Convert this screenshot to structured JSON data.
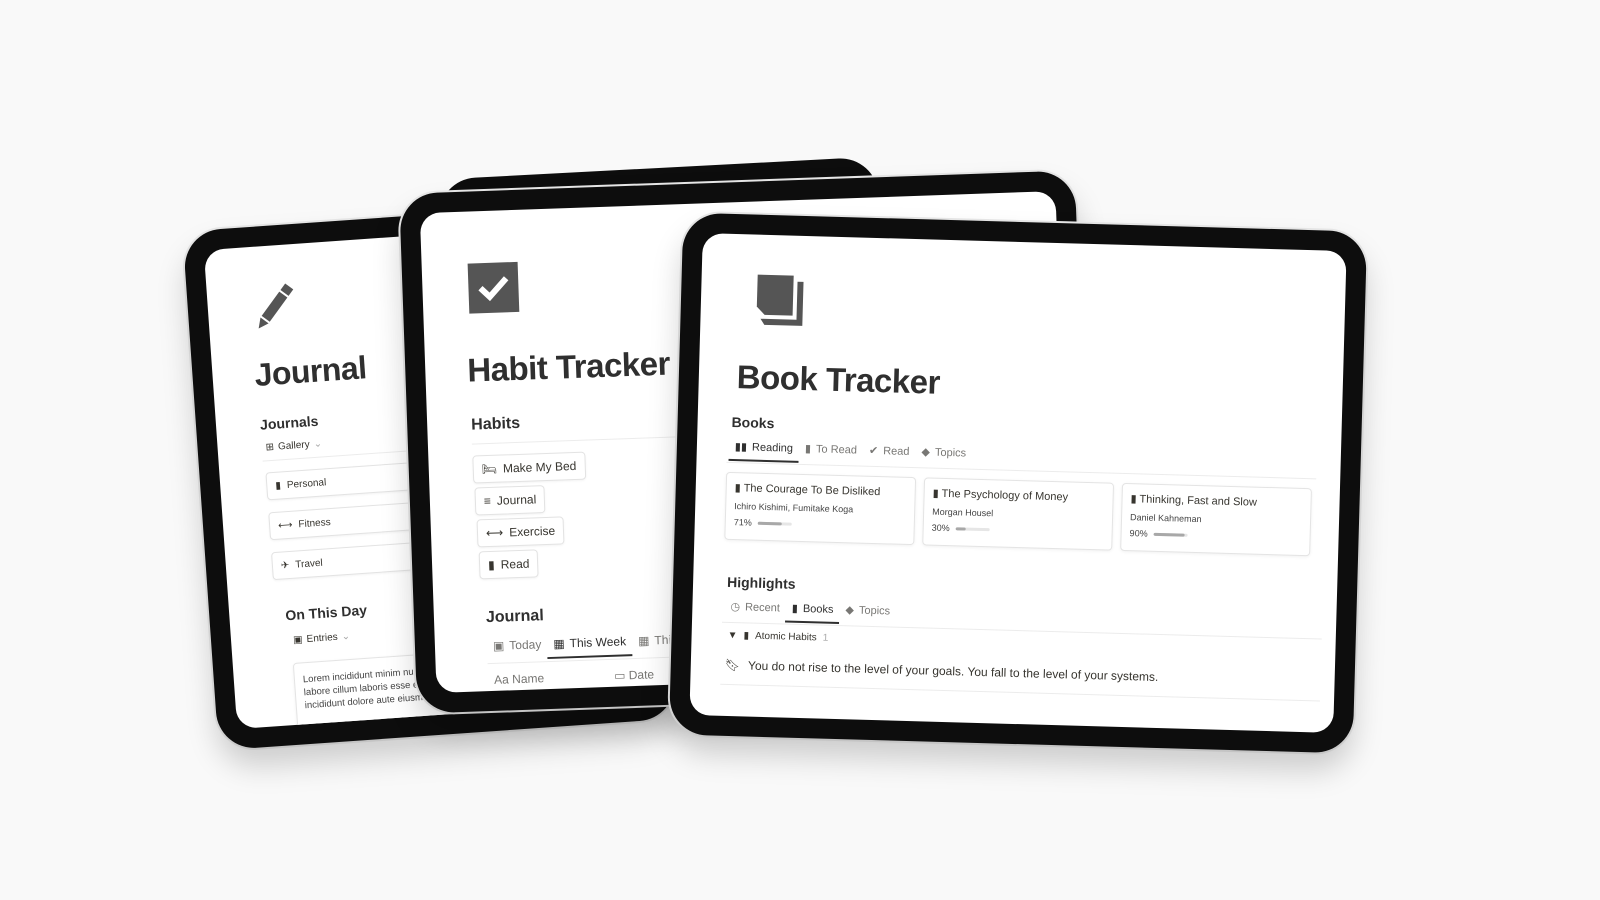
{
  "background_color": "#f9f9f9",
  "journal": {
    "title": "Journal",
    "icon": "pencil-icon",
    "section_journals": "Journals",
    "view_label": "Gallery",
    "gallery_items": [
      {
        "label": "Personal",
        "icon": "book-icon"
      },
      {
        "label": "Fitness",
        "icon": "dumbbell-icon"
      },
      {
        "label": "Travel",
        "icon": "airplane-icon"
      }
    ],
    "section_on_this_day": "On This Day",
    "entries_view_label": "Entries",
    "entry_text": "Lorem incididunt minim nulla est consequat nisi dolor officia ex labore cillum laboris esse eiusmod. Minim veniam deserunt incididunt dolore aute eiusmod ex sit labore adipisicing"
  },
  "habit": {
    "title": "Habit Tracker",
    "icon": "checkbox-icon",
    "section_habits": "Habits",
    "habits": [
      {
        "label": "Make My Bed",
        "icon": "bed-icon"
      },
      {
        "label": "Journal",
        "icon": "pen-lines-icon"
      },
      {
        "label": "Exercise",
        "icon": "dumbbell-icon"
      },
      {
        "label": "Read",
        "icon": "book-icon"
      }
    ],
    "section_journal": "Journal",
    "tabs": [
      {
        "label": "Today",
        "active": false
      },
      {
        "label": "This Week",
        "active": true
      },
      {
        "label": "This",
        "active": false
      }
    ],
    "columns": [
      {
        "label": "Name",
        "prefix": "Aa"
      },
      {
        "label": "Date"
      }
    ]
  },
  "book": {
    "title": "Book Tracker",
    "icon": "book-icon",
    "section_books": "Books",
    "tabs": [
      {
        "label": "Reading",
        "active": true
      },
      {
        "label": "To Read",
        "active": false
      },
      {
        "label": "Read",
        "active": false
      },
      {
        "label": "Topics",
        "active": false
      }
    ],
    "books": [
      {
        "title": "The Courage To Be Disliked",
        "author": "Ichiro Kishimi, Fumitake Koga",
        "progress_label": "71%",
        "progress": 0.71
      },
      {
        "title": "The Psychology of Money",
        "author": "Morgan Housel",
        "progress_label": "30%",
        "progress": 0.3
      },
      {
        "title": "Thinking, Fast and Slow",
        "author": "Daniel Kahneman",
        "progress_label": "90%",
        "progress": 0.9
      }
    ],
    "section_highlights": "Highlights",
    "highlight_tabs": [
      {
        "label": "Recent",
        "active": false
      },
      {
        "label": "Books",
        "active": true
      },
      {
        "label": "Topics",
        "active": false
      }
    ],
    "group": {
      "label": "Atomic Habits",
      "count": "1"
    },
    "highlight_text": "You do not rise to the level of your goals. You fall to the level of your systems."
  }
}
